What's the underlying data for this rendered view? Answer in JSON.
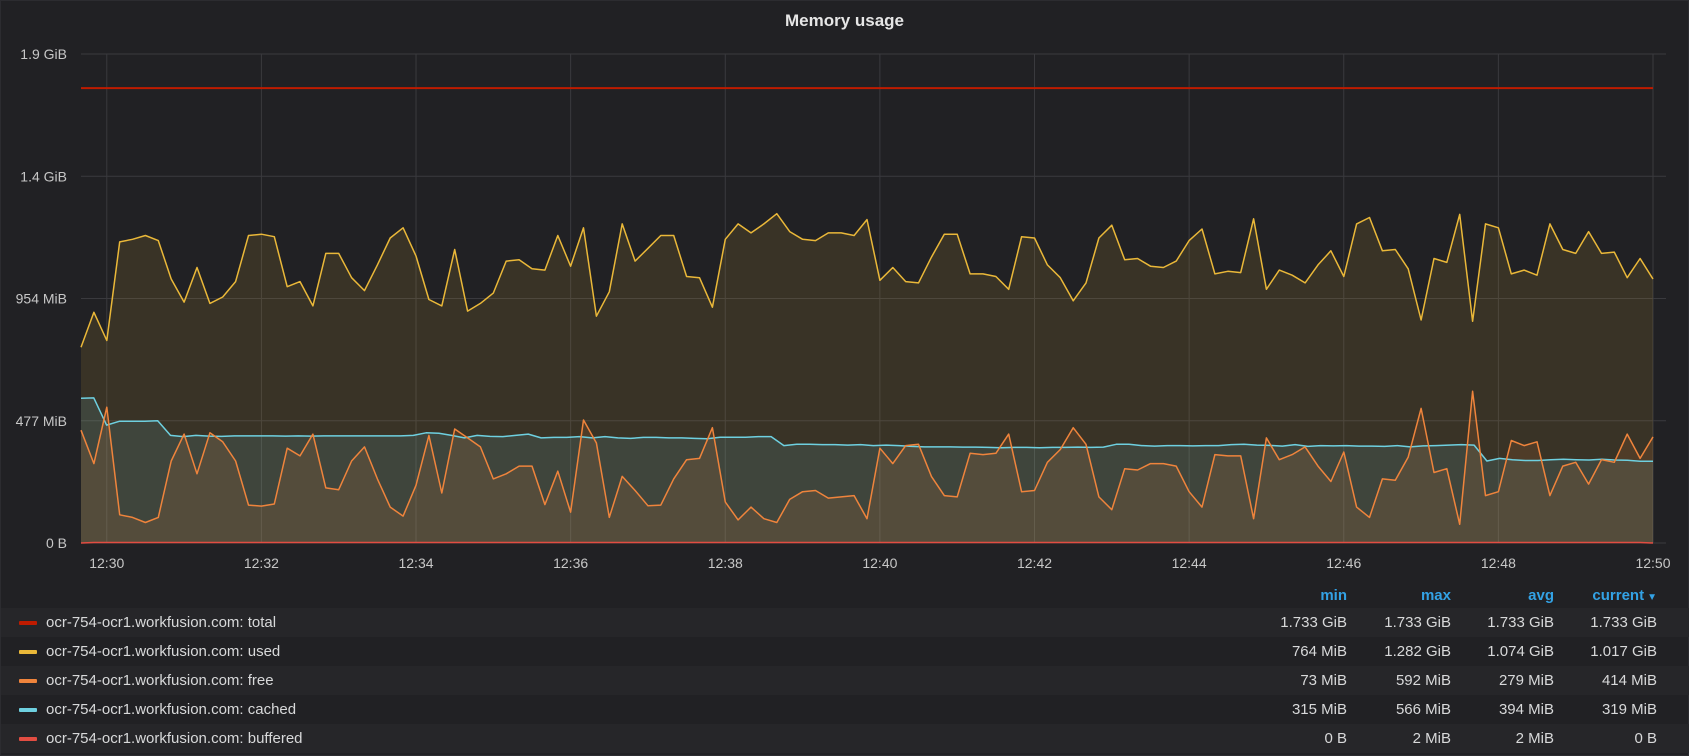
{
  "panel": {
    "title": "Memory usage"
  },
  "legend": {
    "headers": {
      "min": "min",
      "max": "max",
      "avg": "avg",
      "current": "current"
    },
    "sort_icon": "caret-down-icon",
    "rows": [
      {
        "name": "ocr-754-ocr1.workfusion.com: total",
        "color": "#bf1b00",
        "min": "1.733 GiB",
        "max": "1.733 GiB",
        "avg": "1.733 GiB",
        "current": "1.733 GiB"
      },
      {
        "name": "ocr-754-ocr1.workfusion.com: used",
        "color": "#eab839",
        "min": "764 MiB",
        "max": "1.282 GiB",
        "avg": "1.074 GiB",
        "current": "1.017 GiB"
      },
      {
        "name": "ocr-754-ocr1.workfusion.com: free",
        "color": "#ef843c",
        "min": "73 MiB",
        "max": "592 MiB",
        "avg": "279 MiB",
        "current": "414 MiB"
      },
      {
        "name": "ocr-754-ocr1.workfusion.com: cached",
        "color": "#6ed0e0",
        "min": "315 MiB",
        "max": "566 MiB",
        "avg": "394 MiB",
        "current": "319 MiB"
      },
      {
        "name": "ocr-754-ocr1.workfusion.com: buffered",
        "color": "#e24d42",
        "min": "0 B",
        "max": "2 MiB",
        "avg": "2 MiB",
        "current": "0 B"
      }
    ]
  },
  "chart_data": {
    "type": "area",
    "title": "Memory usage",
    "x_ticks": [
      "12:30",
      "12:32",
      "12:34",
      "12:36",
      "12:38",
      "12:40",
      "12:42",
      "12:44",
      "12:46",
      "12:48",
      "12:50"
    ],
    "y_ticks": [
      "0 B",
      "477 MiB",
      "954 MiB",
      "1.4 GiB",
      "1.9 GiB"
    ],
    "y_tick_values_mib": [
      0,
      477,
      954,
      1431,
      1908
    ],
    "ylim_mib": [
      0,
      1908
    ],
    "x_range": [
      "12:29:40",
      "12:50:00"
    ],
    "grid": true,
    "legend_position": "bottom",
    "series": [
      {
        "name": "ocr-754-ocr1.workfusion.com: total",
        "color": "#bf1b00",
        "fill": false,
        "values_mib": [
          1775,
          1775,
          1775,
          1775,
          1775,
          1775,
          1775,
          1775,
          1775,
          1775,
          1775,
          1775,
          1775,
          1775,
          1775,
          1775,
          1775,
          1775,
          1775,
          1775,
          1775,
          1775,
          1775,
          1775,
          1775,
          1775,
          1775,
          1775,
          1775,
          1775,
          1775,
          1775,
          1775,
          1775,
          1775,
          1775,
          1775,
          1775,
          1775,
          1775,
          1775,
          1775,
          1775,
          1775,
          1775,
          1775,
          1775,
          1775,
          1775,
          1775,
          1775,
          1775,
          1775,
          1775,
          1775,
          1775,
          1775,
          1775,
          1775,
          1775,
          1775,
          1775,
          1775,
          1775,
          1775,
          1775,
          1775,
          1775,
          1775,
          1775,
          1775,
          1775,
          1775,
          1775,
          1775,
          1775,
          1775,
          1775,
          1775,
          1775,
          1775,
          1775,
          1775,
          1775,
          1775,
          1775,
          1775,
          1775,
          1775,
          1775,
          1775,
          1775,
          1775,
          1775,
          1775,
          1775,
          1775,
          1775,
          1775,
          1775,
          1775,
          1775,
          1775,
          1775,
          1775,
          1775,
          1775,
          1775,
          1775,
          1775,
          1775,
          1775,
          1775,
          1775,
          1775,
          1775,
          1775,
          1775,
          1775,
          1775,
          1775,
          1775,
          1775
        ]
      },
      {
        "name": "ocr-754-ocr1.workfusion.com: used",
        "color": "#eab839",
        "fill": true,
        "values_mib": [
          764,
          900,
          790,
          1175,
          1185,
          1200,
          1180,
          1030,
          940,
          1075,
          935,
          960,
          1020,
          1200,
          1205,
          1195,
          1000,
          1020,
          925,
          1130,
          1130,
          1035,
          985,
          1085,
          1190,
          1230,
          1120,
          950,
          925,
          1145,
          905,
          935,
          975,
          1100,
          1105,
          1070,
          1065,
          1200,
          1080,
          1230,
          885,
          980,
          1245,
          1100,
          1150,
          1200,
          1200,
          1040,
          1035,
          920,
          1185,
          1245,
          1210,
          1245,
          1285,
          1215,
          1185,
          1180,
          1210,
          1210,
          1200,
          1262,
          1025,
          1075,
          1020,
          1015,
          1115,
          1205,
          1205,
          1050,
          1050,
          1040,
          990,
          1195,
          1190,
          1085,
          1035,
          945,
          1015,
          1190,
          1240,
          1105,
          1110,
          1080,
          1075,
          1100,
          1180,
          1225,
          1050,
          1060,
          1055,
          1265,
          990,
          1065,
          1045,
          1015,
          1085,
          1140,
          1040,
          1245,
          1270,
          1140,
          1145,
          1070,
          870,
          1110,
          1095,
          1282,
          865,
          1245,
          1230,
          1050,
          1065,
          1045,
          1245,
          1145,
          1130,
          1215,
          1130,
          1135,
          1035,
          1110,
          1030
        ]
      },
      {
        "name": "ocr-754-ocr1.workfusion.com: cached",
        "color": "#6ed0e0",
        "fill": true,
        "values_mib": [
          565,
          566,
          460,
          475,
          475,
          475,
          477,
          420,
          415,
          420,
          417,
          416,
          418,
          418,
          418,
          418,
          417,
          418,
          417,
          418,
          418,
          418,
          418,
          418,
          418,
          418,
          420,
          430,
          428,
          420,
          410,
          420,
          416,
          415,
          420,
          425,
          410,
          412,
          412,
          415,
          410,
          415,
          410,
          408,
          412,
          412,
          410,
          410,
          408,
          407,
          413,
          413,
          413,
          415,
          415,
          380,
          385,
          385,
          384,
          384,
          382,
          384,
          380,
          382,
          380,
          377,
          375,
          375,
          375,
          374,
          374,
          373,
          372,
          373,
          373,
          372,
          373,
          373,
          374,
          373,
          374,
          385,
          385,
          380,
          378,
          380,
          380,
          379,
          380,
          380,
          384,
          385,
          382,
          381,
          378,
          384,
          377,
          380,
          379,
          380,
          378,
          378,
          377,
          380,
          375,
          379,
          380,
          382,
          384,
          382,
          320,
          330,
          325,
          322,
          322,
          325,
          327,
          325,
          324,
          327,
          324,
          323,
          319,
          319
        ]
      },
      {
        "name": "ocr-754-ocr1.workfusion.com: free",
        "color": "#ef843c",
        "fill": true,
        "values_mib": [
          440,
          310,
          530,
          110,
          100,
          80,
          100,
          320,
          425,
          270,
          430,
          395,
          320,
          148,
          144,
          152,
          370,
          340,
          425,
          215,
          208,
          320,
          375,
          250,
          140,
          105,
          225,
          420,
          195,
          445,
          410,
          375,
          250,
          270,
          300,
          300,
          150,
          280,
          120,
          480,
          390,
          100,
          260,
          205,
          145,
          148,
          250,
          325,
          330,
          450,
          160,
          90,
          140,
          95,
          80,
          170,
          200,
          205,
          175,
          180,
          185,
          95,
          370,
          310,
          380,
          385,
          260,
          185,
          180,
          350,
          345,
          350,
          425,
          200,
          205,
          315,
          365,
          450,
          385,
          180,
          130,
          290,
          285,
          310,
          310,
          300,
          200,
          140,
          345,
          340,
          340,
          95,
          410,
          325,
          345,
          375,
          300,
          240,
          355,
          140,
          100,
          250,
          245,
          335,
          525,
          275,
          290,
          73,
          592,
          185,
          200,
          400,
          380,
          395,
          185,
          300,
          315,
          230,
          325,
          315,
          425,
          330,
          414
        ]
      },
      {
        "name": "ocr-754-ocr1.workfusion.com: buffered",
        "color": "#e24d42",
        "fill": false,
        "values_mib": [
          0,
          2,
          2,
          2,
          2,
          2,
          2,
          2,
          2,
          2,
          2,
          2,
          2,
          2,
          2,
          2,
          2,
          2,
          2,
          2,
          2,
          2,
          2,
          2,
          2,
          2,
          2,
          2,
          2,
          2,
          2,
          2,
          2,
          2,
          2,
          2,
          2,
          2,
          2,
          2,
          2,
          2,
          2,
          2,
          2,
          2,
          2,
          2,
          2,
          2,
          2,
          2,
          2,
          2,
          2,
          2,
          2,
          2,
          2,
          2,
          2,
          2,
          2,
          2,
          2,
          2,
          2,
          2,
          2,
          2,
          2,
          2,
          2,
          2,
          2,
          2,
          2,
          2,
          2,
          2,
          2,
          2,
          2,
          2,
          2,
          2,
          2,
          2,
          2,
          2,
          2,
          2,
          2,
          2,
          2,
          2,
          2,
          2,
          2,
          2,
          2,
          2,
          2,
          2,
          2,
          2,
          2,
          2,
          2,
          2,
          2,
          2,
          2,
          2,
          2,
          2,
          2,
          2,
          2,
          2,
          2,
          2,
          0
        ]
      }
    ]
  }
}
